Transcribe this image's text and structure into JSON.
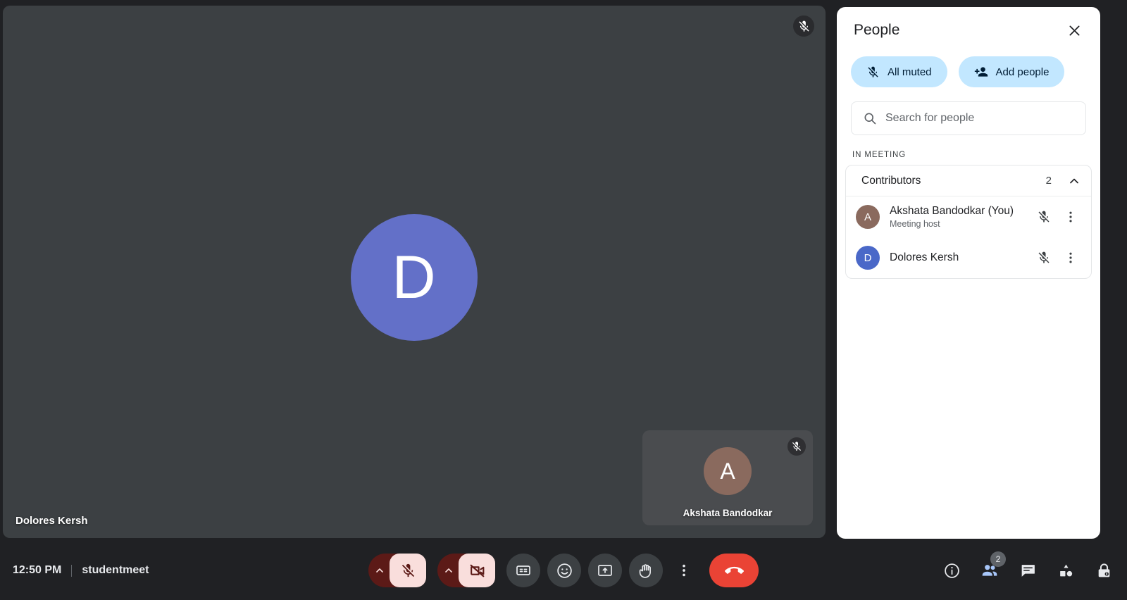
{
  "meeting": {
    "time": "12:50 PM",
    "code": "studentmeet"
  },
  "stage": {
    "main_tile": {
      "name": "Dolores Kersh",
      "avatar_letter": "D",
      "avatar_color": "#6370c8",
      "muted": true,
      "mic_icon": "mic-off-icon"
    },
    "self_tile": {
      "name": "Akshata Bandodkar",
      "avatar_letter": "A",
      "avatar_color": "#8a6a5e",
      "muted": true,
      "mic_icon": "mic-off-icon"
    }
  },
  "people_panel": {
    "title": "People",
    "close_icon": "close-icon",
    "chips": [
      {
        "label": "All muted",
        "icon": "mic-off-icon"
      },
      {
        "label": "Add people",
        "icon": "person-add-icon"
      }
    ],
    "search": {
      "placeholder": "Search for people",
      "value": "",
      "icon": "search-icon"
    },
    "section_label": "IN MEETING",
    "group": {
      "name": "Contributors",
      "count": "2",
      "expanded": true,
      "chevron_icon": "chevron-up-icon"
    },
    "participants": [
      {
        "name": "Akshata Bandodkar (You)",
        "subtitle": "Meeting host",
        "avatar_letter": "A",
        "avatar_color": "#8a6a5e",
        "mic_icon": "mic-off-icon",
        "more_icon": "more-vert-icon"
      },
      {
        "name": "Dolores Kersh",
        "subtitle": "",
        "avatar_letter": "D",
        "avatar_color": "#4a68c8",
        "mic_icon": "mic-off-icon",
        "more_icon": "more-vert-icon"
      }
    ]
  },
  "toolbar": {
    "mic": {
      "name": "microphone-toggle",
      "state": "muted",
      "icon": "mic-off-icon",
      "expand_icon": "chevron-up-icon"
    },
    "camera": {
      "name": "camera-toggle",
      "state": "off",
      "icon": "video-off-icon",
      "expand_icon": "chevron-up-icon"
    },
    "captions": {
      "name": "captions-toggle",
      "icon": "closed-caption-icon"
    },
    "reactions": {
      "name": "reactions-button",
      "icon": "emoji-icon"
    },
    "present": {
      "name": "present-screen-button",
      "icon": "present-screen-icon"
    },
    "raise_hand": {
      "name": "raise-hand-button",
      "icon": "raise-hand-icon"
    },
    "more": {
      "name": "more-options-button",
      "icon": "more-vert-icon"
    },
    "end_call": {
      "name": "end-call-button",
      "icon": "call-end-icon"
    }
  },
  "right_controls": [
    {
      "name": "meeting-details-button",
      "icon": "info-icon",
      "active": false,
      "badge": ""
    },
    {
      "name": "people-panel-button",
      "icon": "people-icon",
      "active": true,
      "badge": "2"
    },
    {
      "name": "chat-panel-button",
      "icon": "chat-icon",
      "active": false,
      "badge": ""
    },
    {
      "name": "activities-button",
      "icon": "activities-icon",
      "active": false,
      "badge": ""
    },
    {
      "name": "host-controls-button",
      "icon": "lock-icon",
      "active": false,
      "badge": ""
    }
  ],
  "colors": {
    "background": "#202124",
    "tile": "#3c4043",
    "panel": "#ffffff",
    "chip": "#c2e7ff",
    "danger": "#ea4335",
    "mute_active": "#f9dedc",
    "mute_arrow": "#5c1a17",
    "accent_blue": "#a8c7fa"
  }
}
